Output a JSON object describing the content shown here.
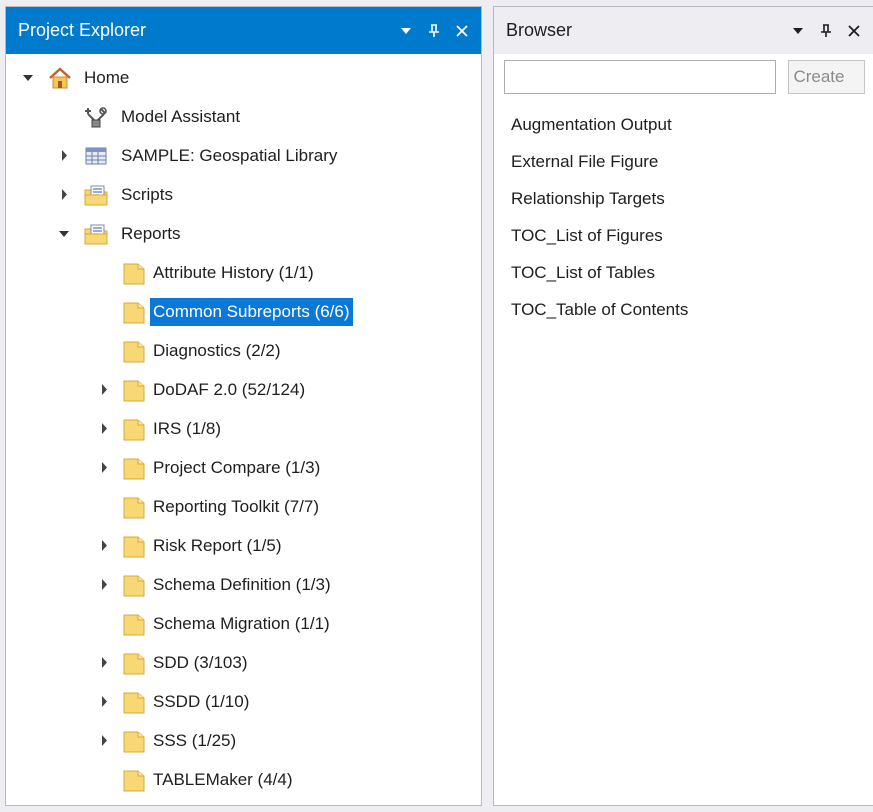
{
  "project_explorer": {
    "title": "Project Explorer",
    "tree": [
      {
        "label": "Home",
        "level": 0,
        "expander": "expanded",
        "icon": "home-icon"
      },
      {
        "label": "Model Assistant",
        "level": 1,
        "expander": "none",
        "icon": "model-assistant-icon"
      },
      {
        "label": "SAMPLE: Geospatial Library",
        "level": 1,
        "expander": "collapsed",
        "icon": "library-icon"
      },
      {
        "label": "Scripts",
        "level": 1,
        "expander": "collapsed",
        "icon": "scripts-folder-icon"
      },
      {
        "label": "Reports",
        "level": 1,
        "expander": "expanded",
        "icon": "reports-folder-icon"
      },
      {
        "label": "Attribute History  (1/1)",
        "level": 2,
        "expander": "none",
        "icon": "folder-icon"
      },
      {
        "label": "Common Subreports  (6/6)",
        "level": 2,
        "expander": "none",
        "icon": "folder-icon",
        "selected": true
      },
      {
        "label": "Diagnostics  (2/2)",
        "level": 2,
        "expander": "none",
        "icon": "folder-icon"
      },
      {
        "label": "DoDAF 2.0  (52/124)",
        "level": 2,
        "expander": "collapsed",
        "icon": "folder-icon"
      },
      {
        "label": "IRS  (1/8)",
        "level": 2,
        "expander": "collapsed",
        "icon": "folder-icon"
      },
      {
        "label": "Project Compare  (1/3)",
        "level": 2,
        "expander": "collapsed",
        "icon": "folder-icon"
      },
      {
        "label": "Reporting Toolkit  (7/7)",
        "level": 2,
        "expander": "none",
        "icon": "folder-icon"
      },
      {
        "label": "Risk Report  (1/5)",
        "level": 2,
        "expander": "collapsed",
        "icon": "folder-icon"
      },
      {
        "label": "Schema Definition  (1/3)",
        "level": 2,
        "expander": "collapsed",
        "icon": "folder-icon"
      },
      {
        "label": "Schema Migration  (1/1)",
        "level": 2,
        "expander": "none",
        "icon": "folder-icon"
      },
      {
        "label": "SDD  (3/103)",
        "level": 2,
        "expander": "collapsed",
        "icon": "folder-icon"
      },
      {
        "label": "SSDD  (1/10)",
        "level": 2,
        "expander": "collapsed",
        "icon": "folder-icon"
      },
      {
        "label": "SSS  (1/25)",
        "level": 2,
        "expander": "collapsed",
        "icon": "folder-icon"
      },
      {
        "label": "TABLEMaker  (4/4)",
        "level": 2,
        "expander": "none",
        "icon": "folder-icon"
      }
    ]
  },
  "browser": {
    "title": "Browser",
    "search": {
      "value": "",
      "placeholder": ""
    },
    "create_label": "Create",
    "items": [
      "Augmentation Output",
      "External File Figure",
      "Relationship Targets",
      "TOC_List of Figures",
      "TOC_List of Tables",
      "TOC_Table of Contents"
    ]
  },
  "colors": {
    "active_title_bg": "#007acc",
    "selection_bg": "#0a78d7",
    "folder_fill": "#f8d775",
    "folder_stroke": "#d9a83b"
  }
}
